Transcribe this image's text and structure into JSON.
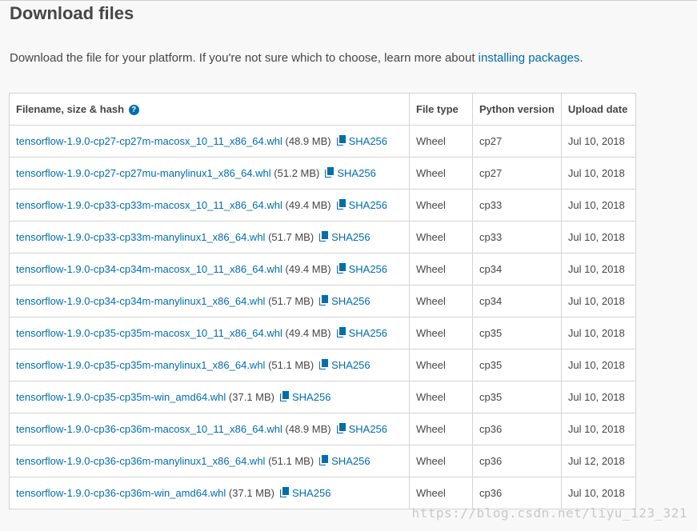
{
  "section": {
    "title": "Download files",
    "intro_text": "Download the file for your platform. If you're not sure which to choose, learn more about ",
    "intro_link": "installing packages",
    "intro_end": "."
  },
  "table": {
    "headers": {
      "filename": "Filename, size & hash",
      "help_glyph": "?",
      "file_type": "File type",
      "python_version": "Python version",
      "upload_date": "Upload date"
    },
    "rows": [
      {
        "filename": "tensorflow-1.9.0-cp27-cp27m-macosx_10_11_x86_64.whl",
        "size": "(48.9 MB)",
        "hash": "SHA256",
        "type": "Wheel",
        "python": "cp27",
        "date": "Jul 10, 2018"
      },
      {
        "filename": "tensorflow-1.9.0-cp27-cp27mu-manylinux1_x86_64.whl",
        "size": "(51.2 MB)",
        "hash": "SHA256",
        "type": "Wheel",
        "python": "cp27",
        "date": "Jul 10, 2018"
      },
      {
        "filename": "tensorflow-1.9.0-cp33-cp33m-macosx_10_11_x86_64.whl",
        "size": "(49.4 MB)",
        "hash": "SHA256",
        "type": "Wheel",
        "python": "cp33",
        "date": "Jul 10, 2018"
      },
      {
        "filename": "tensorflow-1.9.0-cp33-cp33m-manylinux1_x86_64.whl",
        "size": "(51.7 MB)",
        "hash": "SHA256",
        "type": "Wheel",
        "python": "cp33",
        "date": "Jul 10, 2018"
      },
      {
        "filename": "tensorflow-1.9.0-cp34-cp34m-macosx_10_11_x86_64.whl",
        "size": "(49.4 MB)",
        "hash": "SHA256",
        "type": "Wheel",
        "python": "cp34",
        "date": "Jul 10, 2018"
      },
      {
        "filename": "tensorflow-1.9.0-cp34-cp34m-manylinux1_x86_64.whl",
        "size": "(51.7 MB)",
        "hash": "SHA256",
        "type": "Wheel",
        "python": "cp34",
        "date": "Jul 10, 2018"
      },
      {
        "filename": "tensorflow-1.9.0-cp35-cp35m-macosx_10_11_x86_64.whl",
        "size": "(49.4 MB)",
        "hash": "SHA256",
        "type": "Wheel",
        "python": "cp35",
        "date": "Jul 10, 2018"
      },
      {
        "filename": "tensorflow-1.9.0-cp35-cp35m-manylinux1_x86_64.whl",
        "size": "(51.1 MB)",
        "hash": "SHA256",
        "type": "Wheel",
        "python": "cp35",
        "date": "Jul 10, 2018"
      },
      {
        "filename": "tensorflow-1.9.0-cp35-cp35m-win_amd64.whl",
        "size": "(37.1 MB)",
        "hash": "SHA256",
        "type": "Wheel",
        "python": "cp35",
        "date": "Jul 10, 2018"
      },
      {
        "filename": "tensorflow-1.9.0-cp36-cp36m-macosx_10_11_x86_64.whl",
        "size": "(48.9 MB)",
        "hash": "SHA256",
        "type": "Wheel",
        "python": "cp36",
        "date": "Jul 10, 2018"
      },
      {
        "filename": "tensorflow-1.9.0-cp36-cp36m-manylinux1_x86_64.whl",
        "size": "(51.1 MB)",
        "hash": "SHA256",
        "type": "Wheel",
        "python": "cp36",
        "date": "Jul 12, 2018"
      },
      {
        "filename": "tensorflow-1.9.0-cp36-cp36m-win_amd64.whl",
        "size": "(37.1 MB)",
        "hash": "SHA256",
        "type": "Wheel",
        "python": "cp36",
        "date": "Jul 10, 2018"
      }
    ]
  },
  "watermark": "https://blog.csdn.net/liyu_123_321",
  "colors": {
    "link": "#006dad",
    "text": "#464646",
    "background": "#f8f8f8",
    "border": "#d3d3d3"
  },
  "icons": {
    "help": "question-circle-icon",
    "hash": "copy-icon"
  }
}
